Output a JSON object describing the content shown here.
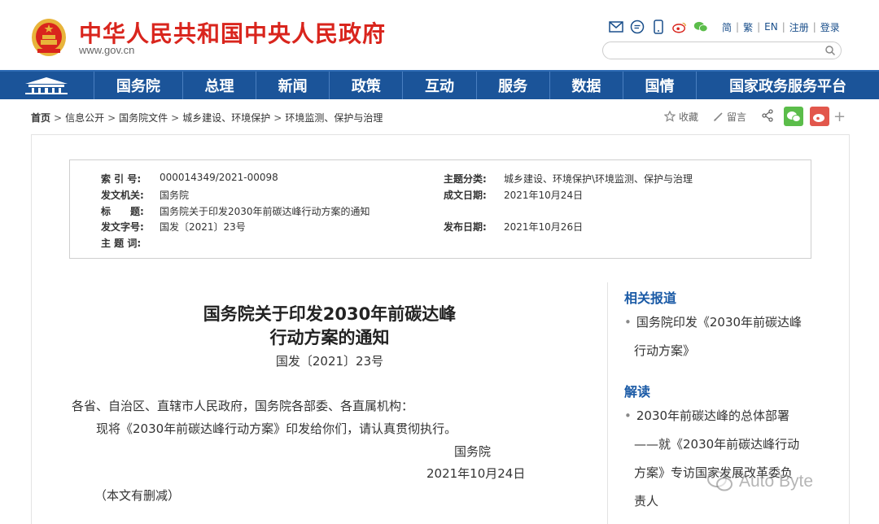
{
  "header": {
    "site_title": "中华人民共和国中央人民政府",
    "site_url": "www.gov.cn",
    "lang_links": [
      "简",
      "繁",
      "EN",
      "注册",
      "登录"
    ],
    "search_placeholder": ""
  },
  "nav": {
    "items": [
      "国务院",
      "总理",
      "新闻",
      "政策",
      "互动",
      "服务",
      "数据",
      "国情",
      "国家政务服务平台"
    ]
  },
  "breadcrumb": [
    "首页",
    "信息公开",
    "国务院文件",
    "城乡建设、环境保护",
    "环境监测、保护与治理"
  ],
  "share": {
    "favorite": "收藏",
    "comment": "留言",
    "plus": "+"
  },
  "meta": {
    "index_label": "索 引 号:",
    "index_value": "000014349/2021-00098",
    "topic_label": "主题分类:",
    "topic_value": "城乡建设、环境保护\\环境监测、保护与治理",
    "issuer_label": "发文机关:",
    "issuer_value": "国务院",
    "date_label": "成文日期:",
    "date_value": "2021年10月24日",
    "title_label": "标　　题:",
    "title_value": "国务院关于印发2030年前碳达峰行动方案的通知",
    "docno_label": "发文字号:",
    "docno_value": "国发〔2021〕23号",
    "pub_label": "发布日期:",
    "pub_value": "2021年10月26日",
    "keywords_label": "主 题 词:"
  },
  "article": {
    "title_line1": "国务院关于印发2030年前碳达峰",
    "title_line2": "行动方案的通知",
    "doc_number": "国发〔2021〕23号",
    "addressee": "各省、自治区、直辖市人民政府，国务院各部委、各直属机构：",
    "body": "现将《2030年前碳达峰行动方案》印发给你们，请认真贯彻执行。",
    "signer": "国务院",
    "date": "2021年10月24日",
    "note": "（本文有删减）"
  },
  "sidebar": {
    "related_heading": "相关报道",
    "related_line1": "国务院印发《2030年前碳达峰",
    "related_line2": "行动方案》",
    "interp_heading": "解读",
    "interp_line1": "2030年前碳达峰的总体部署",
    "interp_line2": "——就《2030年前碳达峰行动",
    "interp_line3": "方案》专访国家发展改革委负",
    "interp_line4": "责人"
  },
  "watermark": {
    "text": "Auto Byte"
  },
  "colors": {
    "brand_red": "#d9251d",
    "nav_blue": "#1b5499",
    "link_blue": "#1a5aa6",
    "wechat_green": "#5bbd4a",
    "weibo_red": "#e2574c"
  }
}
